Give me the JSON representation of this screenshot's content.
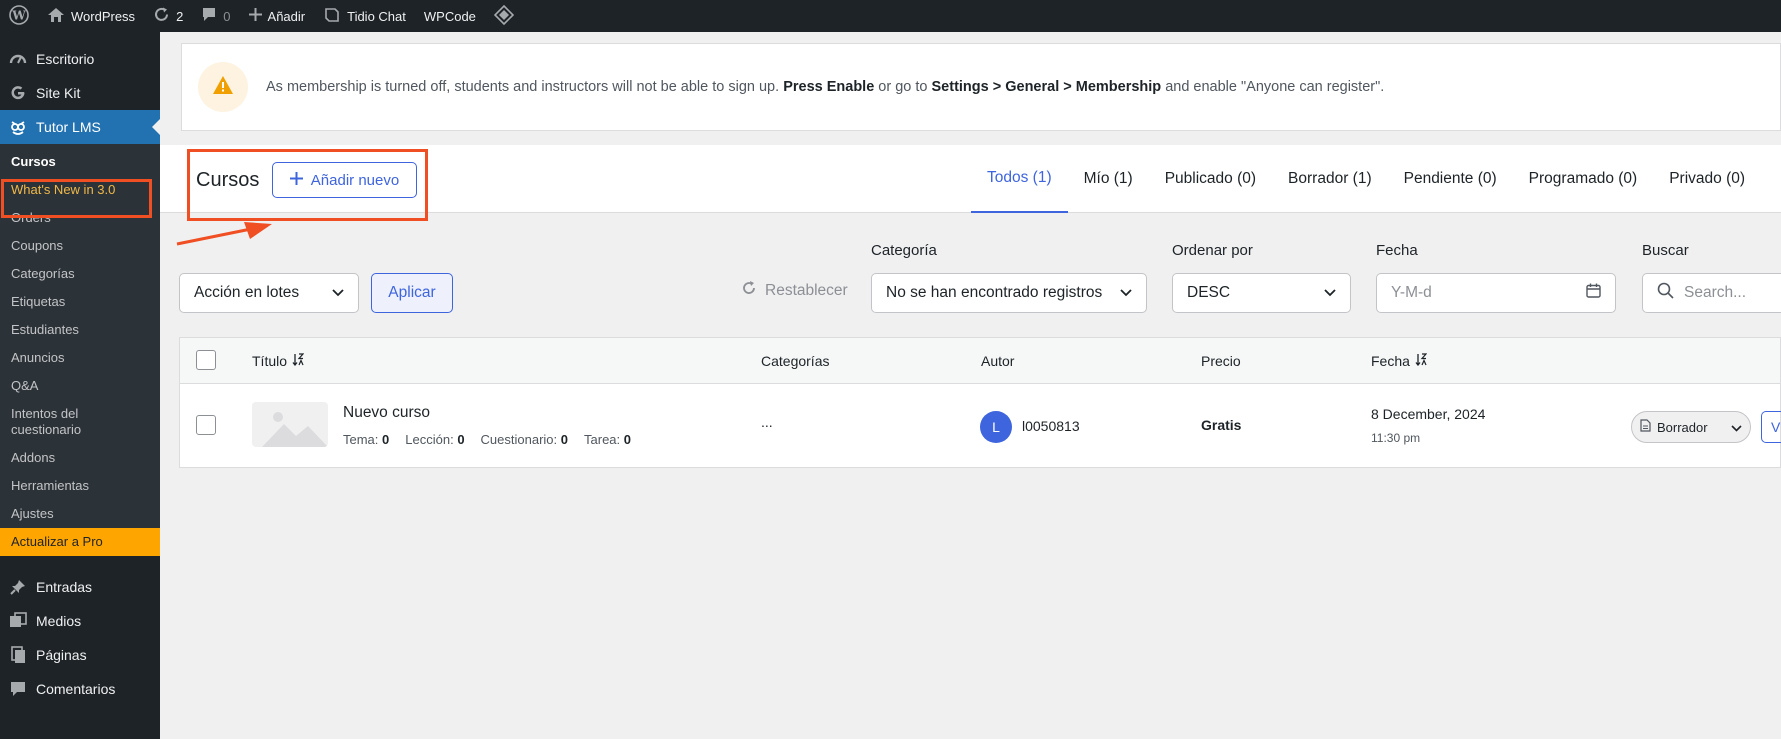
{
  "adminbar": {
    "site_name": "WordPress",
    "updates_count": "2",
    "comments_count": "0",
    "new_label": "Añadir",
    "tidio_label": "Tidio Chat",
    "wpcode_label": "WPCode"
  },
  "sidebar": {
    "items_top": [
      {
        "label": "Escritorio",
        "icon": "dashboard-icon"
      },
      {
        "label": "Site Kit",
        "icon": "google-g-icon"
      },
      {
        "label": "Tutor LMS",
        "icon": "tutor-owl-icon"
      }
    ],
    "submenu": [
      {
        "label": "Cursos"
      },
      {
        "label": "What's New in 3.0"
      },
      {
        "label": "Orders"
      },
      {
        "label": "Coupons"
      },
      {
        "label": "Categorías"
      },
      {
        "label": "Etiquetas"
      },
      {
        "label": "Estudiantes"
      },
      {
        "label": "Anuncios"
      },
      {
        "label": "Q&A"
      },
      {
        "label": "Intentos del cuestionario"
      },
      {
        "label": "Addons"
      },
      {
        "label": "Herramientas"
      },
      {
        "label": "Ajustes"
      },
      {
        "label": "Actualizar a Pro"
      }
    ],
    "items_bottom": [
      {
        "label": "Entradas",
        "icon": "pin-icon"
      },
      {
        "label": "Medios",
        "icon": "media-icon"
      },
      {
        "label": "Páginas",
        "icon": "pages-icon"
      },
      {
        "label": "Comentarios",
        "icon": "comment-icon"
      }
    ]
  },
  "notice": {
    "text_1": "As membership is turned off, students and instructors will not be able to sign up.",
    "bold_1": "Press Enable",
    "text_2": "or go to",
    "bold_2": "Settings > General > Membership",
    "text_3": "and enable \"Anyone can register\"."
  },
  "header": {
    "title": "Cursos",
    "add_new_label": "Añadir nuevo",
    "tabs": [
      {
        "label": "Todos (1)"
      },
      {
        "label": "Mío (1)"
      },
      {
        "label": "Publicado (0)"
      },
      {
        "label": "Borrador (1)"
      },
      {
        "label": "Pendiente (0)"
      },
      {
        "label": "Programado (0)"
      },
      {
        "label": "Privado (0)"
      }
    ]
  },
  "filters": {
    "bulk_action_value": "Acción en lotes",
    "apply_label": "Aplicar",
    "reset_label": "Restablecer",
    "category_label": "Categoría",
    "category_value": "No se han encontrado registros",
    "order_label": "Ordenar por",
    "order_value": "DESC",
    "date_label": "Fecha",
    "date_placeholder": "Y-M-d",
    "search_label": "Buscar",
    "search_placeholder": "Search..."
  },
  "table": {
    "columns": {
      "title": "Título",
      "categories": "Categorías",
      "author": "Autor",
      "price": "Precio",
      "date": "Fecha"
    },
    "rows": [
      {
        "title": "Nuevo curso",
        "meta_tema_label": "Tema:",
        "meta_tema": "0",
        "meta_leccion_label": "Lección:",
        "meta_leccion": "0",
        "meta_cuestionario_label": "Cuestionario:",
        "meta_cuestionario": "0",
        "meta_tarea_label": "Tarea:",
        "meta_tarea": "0",
        "categories": "...",
        "author_initial": "L",
        "author": "l0050813",
        "price": "Gratis",
        "date": "8 December, 2024",
        "time": "11:30 pm",
        "status": "Borrador",
        "view_label": "V"
      }
    ]
  },
  "colors": {
    "accent": "#3e64de",
    "wp_blue": "#2271b1",
    "annotation_red": "#f04e23",
    "upgrade_orange": "#ffa500"
  }
}
